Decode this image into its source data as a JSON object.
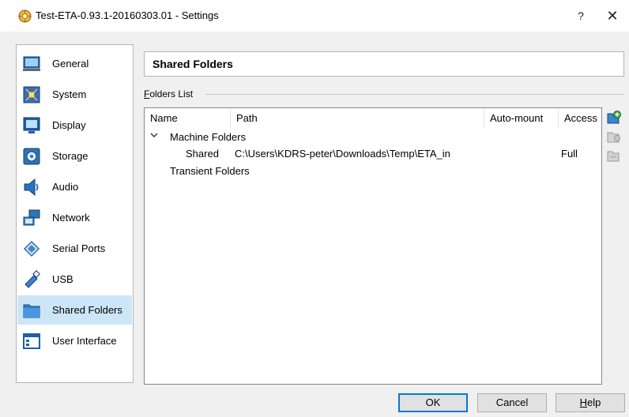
{
  "window": {
    "title": "Test-ETA-0.93.1-20160303.01 - Settings",
    "help_glyph": "?",
    "close_glyph": "✕"
  },
  "sidebar": {
    "items": [
      {
        "label": "General",
        "icon": "general-icon"
      },
      {
        "label": "System",
        "icon": "system-icon"
      },
      {
        "label": "Display",
        "icon": "display-icon"
      },
      {
        "label": "Storage",
        "icon": "storage-icon"
      },
      {
        "label": "Audio",
        "icon": "audio-icon"
      },
      {
        "label": "Network",
        "icon": "network-icon"
      },
      {
        "label": "Serial Ports",
        "icon": "serial-ports-icon"
      },
      {
        "label": "USB",
        "icon": "usb-icon"
      },
      {
        "label": "Shared Folders",
        "icon": "shared-folders-icon",
        "selected": true
      },
      {
        "label": "User Interface",
        "icon": "user-interface-icon"
      }
    ]
  },
  "main": {
    "header_title": "Shared Folders",
    "group_label_first": "F",
    "group_label_rest": "olders List",
    "columns": [
      "Name",
      "Path",
      "Auto-mount",
      "Access"
    ],
    "tree": {
      "machine_folders_label": "Machine Folders",
      "shared_row": {
        "name": "Shared",
        "path": "C:\\Users\\KDRS-peter\\Downloads\\Temp\\ETA_in",
        "auto_mount": "",
        "access": "Full"
      },
      "transient_folders_label": "Transient Folders"
    }
  },
  "buttons": {
    "ok": "OK",
    "cancel": "Cancel",
    "help_first": "H",
    "help_rest": "elp"
  },
  "colors": {
    "selected_bg": "#cde6f7",
    "default_button_border": "#0078d7"
  }
}
